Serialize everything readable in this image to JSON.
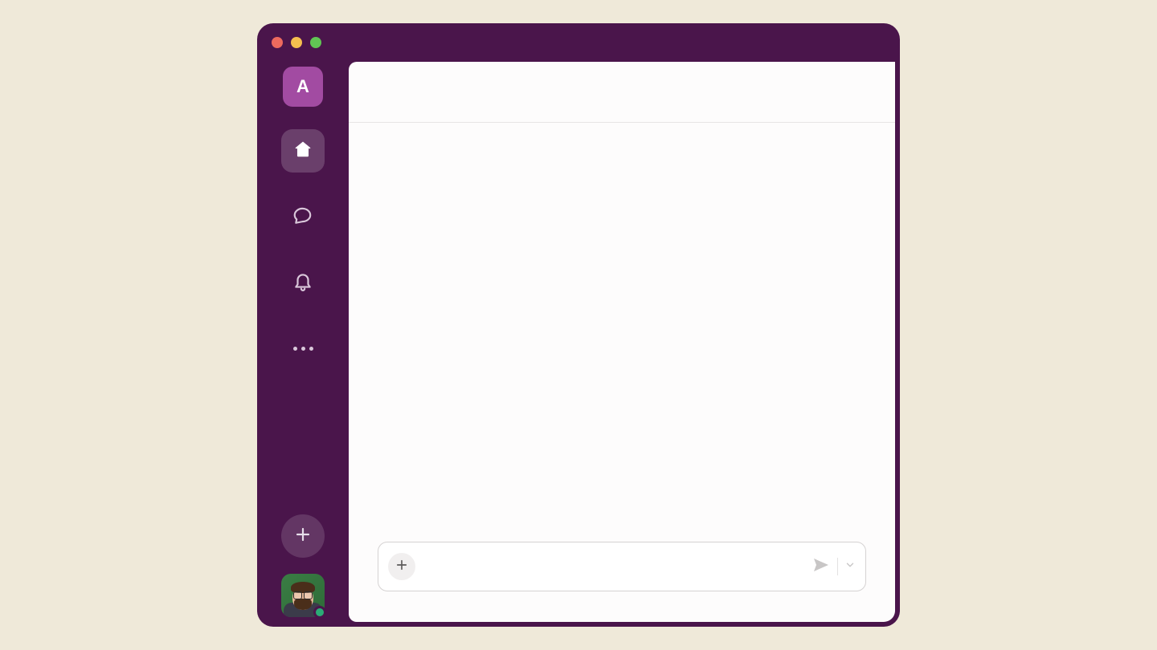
{
  "workspace": {
    "letter": "A"
  },
  "rail": {
    "home": "home-icon",
    "dms": "dms-icon",
    "activity": "bell-icon",
    "more": "more-icon",
    "compose": "plus-icon"
  },
  "user": {
    "presence": "active"
  },
  "composer": {
    "placeholder": "",
    "value": ""
  },
  "colors": {
    "chrome": "#4a154b",
    "accent": "#a24ba2",
    "presence_active": "#2bac76"
  }
}
